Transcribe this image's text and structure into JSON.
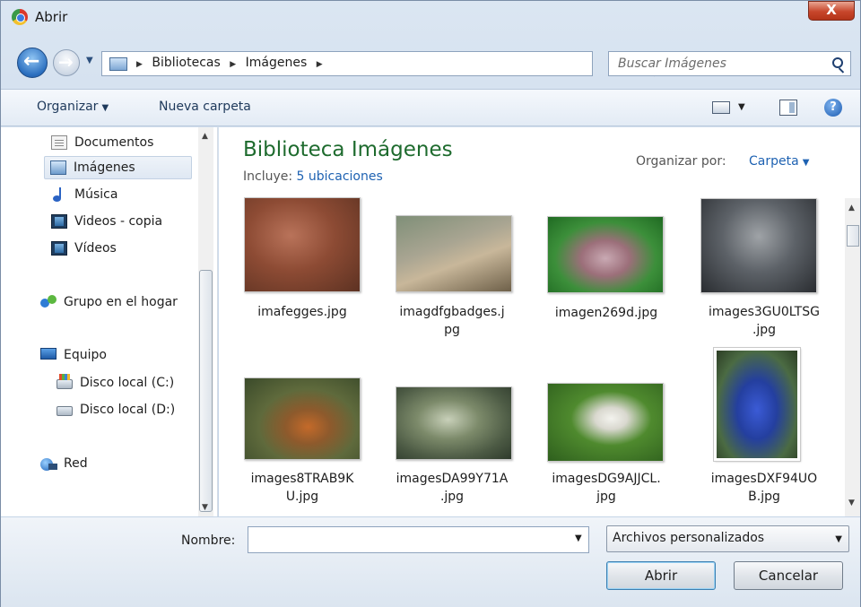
{
  "window": {
    "title": "Abrir",
    "close_label": "X"
  },
  "address_bar": {
    "breadcrumbs": [
      "Bibliotecas",
      "Imágenes"
    ],
    "search_placeholder": "Buscar Imágenes"
  },
  "toolbar": {
    "organize_label": "Organizar",
    "new_folder_label": "Nueva carpeta"
  },
  "nav_pane": {
    "items": [
      {
        "label": "Documentos",
        "icon": "document-icon"
      },
      {
        "label": "Imágenes",
        "icon": "pictures-icon",
        "selected": true
      },
      {
        "label": "Música",
        "icon": "music-icon"
      },
      {
        "label": "Videos - copia",
        "icon": "video-icon"
      },
      {
        "label": "Vídeos",
        "icon": "video-icon"
      },
      {
        "label": "Grupo en el hogar",
        "icon": "homegroup-icon"
      },
      {
        "label": "Equipo",
        "icon": "computer-icon"
      },
      {
        "label": "Disco local (C:)",
        "icon": "drive-c-icon"
      },
      {
        "label": "Disco local (D:)",
        "icon": "drive-icon"
      },
      {
        "label": "Red",
        "icon": "network-icon"
      }
    ]
  },
  "library": {
    "title": "Biblioteca Imágenes",
    "includes_label": "Incluye:",
    "includes_link": "5 ubicaciones",
    "arrange_by_label": "Organizar por:",
    "arrange_by_value": "Carpeta"
  },
  "files": [
    {
      "name_line1": "imafegges.jpg",
      "name_line2": ""
    },
    {
      "name_line1": "imagdfgbadges.j",
      "name_line2": "pg"
    },
    {
      "name_line1": "imagen269d.jpg",
      "name_line2": ""
    },
    {
      "name_line1": "images3GU0LTSG",
      "name_line2": ".jpg"
    },
    {
      "name_line1": "images8TRAB9K",
      "name_line2": "U.jpg"
    },
    {
      "name_line1": "imagesDA99Y71A",
      "name_line2": ".jpg"
    },
    {
      "name_line1": "imagesDG9AJJCL.",
      "name_line2": "jpg"
    },
    {
      "name_line1": "imagesDXF94UO",
      "name_line2": "B.jpg"
    }
  ],
  "footer": {
    "filename_label": "Nombre:",
    "filename_value": "",
    "filter_value": "Archivos personalizados",
    "open_label": "Abrir",
    "cancel_label": "Cancelar"
  }
}
